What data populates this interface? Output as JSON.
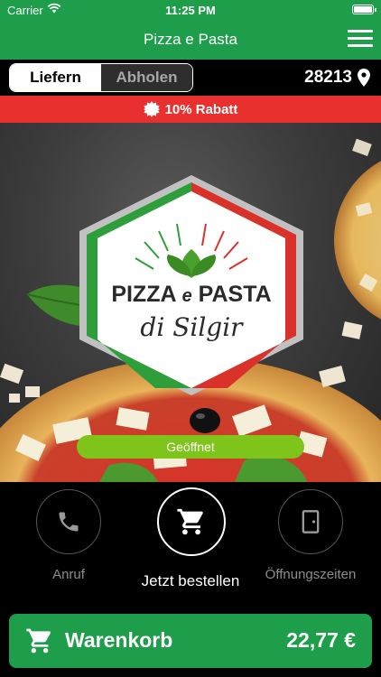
{
  "status_bar": {
    "carrier": "Carrier",
    "time": "11:25 PM"
  },
  "nav": {
    "title": "Pizza e Pasta"
  },
  "delivery": {
    "options": [
      "Liefern",
      "Abholen"
    ],
    "selected": "Liefern",
    "zip": "28213"
  },
  "discount": {
    "label": "10% Rabatt"
  },
  "hero": {
    "logo_text": [
      "PIZZA",
      "e",
      "PASTA",
      "di Silgir"
    ],
    "status": "Geöffnet"
  },
  "actions": {
    "call": {
      "label": "Anruf",
      "icon": "phone-icon"
    },
    "order": {
      "label": "Jetzt bestellen",
      "icon": "cart-icon"
    },
    "hours": {
      "label": "Öffnungszeiten",
      "icon": "door-icon"
    }
  },
  "cart": {
    "label": "Warenkorb",
    "total": "22,77 €"
  },
  "colors": {
    "brand_green": "#1e9e4a",
    "discount_red": "#e8302f",
    "open_green": "#7fc41a"
  }
}
